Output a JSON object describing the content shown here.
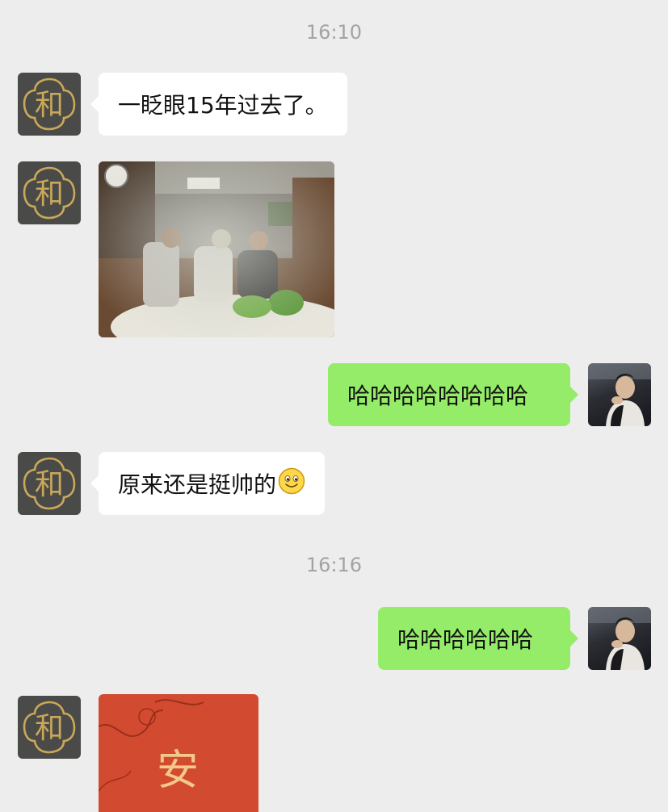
{
  "messages": {
    "time1": "16:10",
    "msg1": "一眨眼15年过去了。",
    "msg3": "哈哈哈哈哈哈哈哈",
    "msg4": "原来还是挺帅的",
    "time2": "16:16",
    "msg5": "哈哈哈哈哈哈",
    "red_envelope_char": "安"
  },
  "avatars": {
    "contact_logo_char": "和"
  },
  "icons": {
    "contact_avatar": "he-logo-icon",
    "user_avatar": "user-photo-avatar",
    "smile_emoji": "smile-emoji-icon"
  },
  "colors": {
    "background": "#ededed",
    "incoming_bubble": "#ffffff",
    "outgoing_bubble": "#95ec69",
    "timestamp": "#a3a3a3",
    "logo_gold": "#c9a85a"
  }
}
